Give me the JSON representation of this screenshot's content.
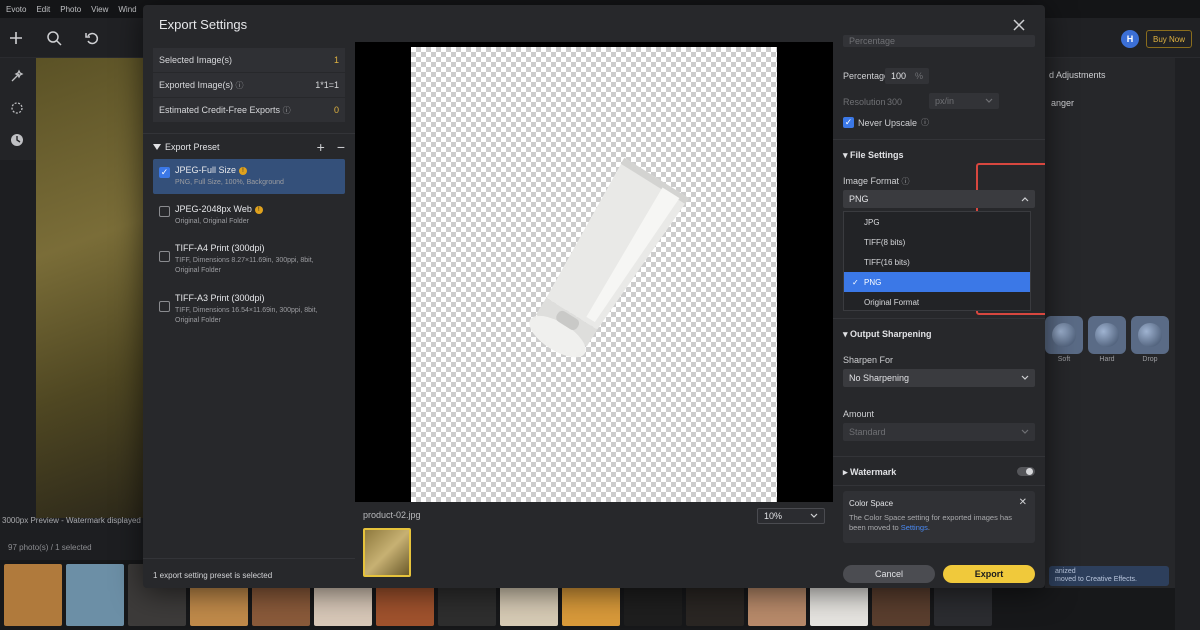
{
  "background": {
    "menu": [
      "Evoto",
      "Edit",
      "Photo",
      "View",
      "Wind"
    ],
    "caption": "3000px Preview - Watermark displayed",
    "photo_count": "97 photo(s) / 1 selected",
    "right_title": "d Adjustments",
    "right_sub": "anger",
    "tone_labels": [
      "Soft",
      "Hard",
      "Drop"
    ],
    "buy_now": "Buy Now",
    "avatar": "H",
    "notice": "anized",
    "notice2": "moved to Creative Effects."
  },
  "dialog": {
    "title": "Export Settings",
    "info": [
      {
        "label": "Selected Image(s)",
        "value": "1"
      },
      {
        "label": "Exported Image(s)",
        "value": "1*1=1"
      },
      {
        "label": "Estimated Credit-Free Exports",
        "value": "0"
      }
    ],
    "preset_header": "Export Preset",
    "presets": [
      {
        "name": "JPEG-Full Size",
        "desc": "PNG, Full Size, 100%, Background",
        "checked": true
      },
      {
        "name": "JPEG-2048px Web",
        "desc": "Original, Original Folder",
        "checked": false
      },
      {
        "name": "TIFF-A4 Print (300dpi)",
        "desc": "TIFF, Dimensions 8.27×11.69in, 300ppi, 8bit, Original Folder",
        "checked": false
      },
      {
        "name": "TIFF-A3 Print (300dpi)",
        "desc": "TIFF, Dimensions 16.54×11.69in, 300ppi, 8bit, Original Folder",
        "checked": false
      }
    ],
    "footer": "1 export setting preset is selected",
    "file_name": "product-02.jpg",
    "zoom": "10%",
    "right": {
      "top_select": "Percentage",
      "percentage_label": "Percentage",
      "percentage_value": "100",
      "percentage_unit": "%",
      "resolution_label": "Resolution",
      "resolution_value": "300",
      "resolution_unit": "px/in",
      "never_upscale": "Never Upscale",
      "file_settings": "File Settings",
      "image_format_label": "Image Format",
      "image_format_value": "PNG",
      "formats": [
        "JPG",
        "TIFF(8 bits)",
        "TIFF(16 bits)",
        "PNG",
        "Original Format"
      ],
      "selected_format": "PNG",
      "output_sharpening": "Output Sharpening",
      "sharpen_for_label": "Sharpen For",
      "sharpen_for_value": "No Sharpening",
      "amount_label": "Amount",
      "amount_value": "Standard",
      "watermark": "Watermark",
      "color_space_title": "Color Space",
      "color_space_text": "The Color Space setting for exported images has been moved to",
      "color_space_link": "Settings",
      "cancel": "Cancel",
      "export": "Export"
    }
  },
  "colors": {
    "accent": "#3b78e7",
    "export": "#f0c93b",
    "highlight_border": "#d8473f"
  }
}
